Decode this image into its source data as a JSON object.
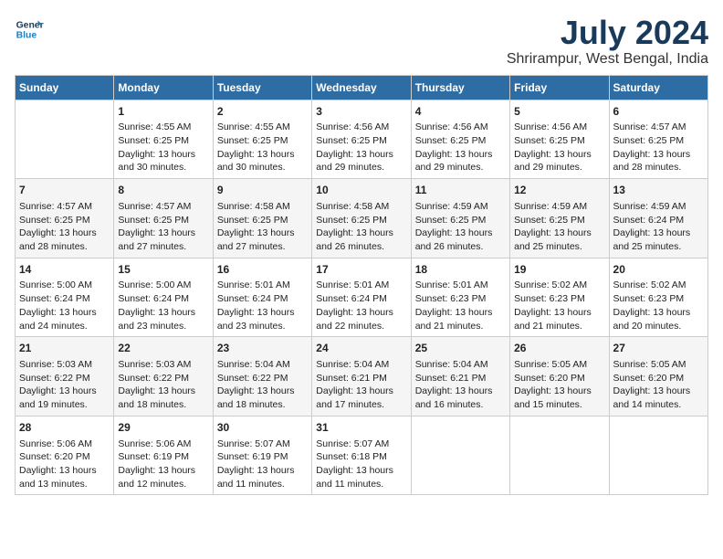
{
  "logo": {
    "line1": "General",
    "line2": "Blue"
  },
  "title": "July 2024",
  "location": "Shrirampur, West Bengal, India",
  "days_of_week": [
    "Sunday",
    "Monday",
    "Tuesday",
    "Wednesday",
    "Thursday",
    "Friday",
    "Saturday"
  ],
  "weeks": [
    [
      {
        "day": "",
        "info": ""
      },
      {
        "day": "1",
        "info": "Sunrise: 4:55 AM\nSunset: 6:25 PM\nDaylight: 13 hours\nand 30 minutes."
      },
      {
        "day": "2",
        "info": "Sunrise: 4:55 AM\nSunset: 6:25 PM\nDaylight: 13 hours\nand 30 minutes."
      },
      {
        "day": "3",
        "info": "Sunrise: 4:56 AM\nSunset: 6:25 PM\nDaylight: 13 hours\nand 29 minutes."
      },
      {
        "day": "4",
        "info": "Sunrise: 4:56 AM\nSunset: 6:25 PM\nDaylight: 13 hours\nand 29 minutes."
      },
      {
        "day": "5",
        "info": "Sunrise: 4:56 AM\nSunset: 6:25 PM\nDaylight: 13 hours\nand 29 minutes."
      },
      {
        "day": "6",
        "info": "Sunrise: 4:57 AM\nSunset: 6:25 PM\nDaylight: 13 hours\nand 28 minutes."
      }
    ],
    [
      {
        "day": "7",
        "info": "Sunrise: 4:57 AM\nSunset: 6:25 PM\nDaylight: 13 hours\nand 28 minutes."
      },
      {
        "day": "8",
        "info": "Sunrise: 4:57 AM\nSunset: 6:25 PM\nDaylight: 13 hours\nand 27 minutes."
      },
      {
        "day": "9",
        "info": "Sunrise: 4:58 AM\nSunset: 6:25 PM\nDaylight: 13 hours\nand 27 minutes."
      },
      {
        "day": "10",
        "info": "Sunrise: 4:58 AM\nSunset: 6:25 PM\nDaylight: 13 hours\nand 26 minutes."
      },
      {
        "day": "11",
        "info": "Sunrise: 4:59 AM\nSunset: 6:25 PM\nDaylight: 13 hours\nand 26 minutes."
      },
      {
        "day": "12",
        "info": "Sunrise: 4:59 AM\nSunset: 6:25 PM\nDaylight: 13 hours\nand 25 minutes."
      },
      {
        "day": "13",
        "info": "Sunrise: 4:59 AM\nSunset: 6:24 PM\nDaylight: 13 hours\nand 25 minutes."
      }
    ],
    [
      {
        "day": "14",
        "info": "Sunrise: 5:00 AM\nSunset: 6:24 PM\nDaylight: 13 hours\nand 24 minutes."
      },
      {
        "day": "15",
        "info": "Sunrise: 5:00 AM\nSunset: 6:24 PM\nDaylight: 13 hours\nand 23 minutes."
      },
      {
        "day": "16",
        "info": "Sunrise: 5:01 AM\nSunset: 6:24 PM\nDaylight: 13 hours\nand 23 minutes."
      },
      {
        "day": "17",
        "info": "Sunrise: 5:01 AM\nSunset: 6:24 PM\nDaylight: 13 hours\nand 22 minutes."
      },
      {
        "day": "18",
        "info": "Sunrise: 5:01 AM\nSunset: 6:23 PM\nDaylight: 13 hours\nand 21 minutes."
      },
      {
        "day": "19",
        "info": "Sunrise: 5:02 AM\nSunset: 6:23 PM\nDaylight: 13 hours\nand 21 minutes."
      },
      {
        "day": "20",
        "info": "Sunrise: 5:02 AM\nSunset: 6:23 PM\nDaylight: 13 hours\nand 20 minutes."
      }
    ],
    [
      {
        "day": "21",
        "info": "Sunrise: 5:03 AM\nSunset: 6:22 PM\nDaylight: 13 hours\nand 19 minutes."
      },
      {
        "day": "22",
        "info": "Sunrise: 5:03 AM\nSunset: 6:22 PM\nDaylight: 13 hours\nand 18 minutes."
      },
      {
        "day": "23",
        "info": "Sunrise: 5:04 AM\nSunset: 6:22 PM\nDaylight: 13 hours\nand 18 minutes."
      },
      {
        "day": "24",
        "info": "Sunrise: 5:04 AM\nSunset: 6:21 PM\nDaylight: 13 hours\nand 17 minutes."
      },
      {
        "day": "25",
        "info": "Sunrise: 5:04 AM\nSunset: 6:21 PM\nDaylight: 13 hours\nand 16 minutes."
      },
      {
        "day": "26",
        "info": "Sunrise: 5:05 AM\nSunset: 6:20 PM\nDaylight: 13 hours\nand 15 minutes."
      },
      {
        "day": "27",
        "info": "Sunrise: 5:05 AM\nSunset: 6:20 PM\nDaylight: 13 hours\nand 14 minutes."
      }
    ],
    [
      {
        "day": "28",
        "info": "Sunrise: 5:06 AM\nSunset: 6:20 PM\nDaylight: 13 hours\nand 13 minutes."
      },
      {
        "day": "29",
        "info": "Sunrise: 5:06 AM\nSunset: 6:19 PM\nDaylight: 13 hours\nand 12 minutes."
      },
      {
        "day": "30",
        "info": "Sunrise: 5:07 AM\nSunset: 6:19 PM\nDaylight: 13 hours\nand 11 minutes."
      },
      {
        "day": "31",
        "info": "Sunrise: 5:07 AM\nSunset: 6:18 PM\nDaylight: 13 hours\nand 11 minutes."
      },
      {
        "day": "",
        "info": ""
      },
      {
        "day": "",
        "info": ""
      },
      {
        "day": "",
        "info": ""
      }
    ]
  ]
}
